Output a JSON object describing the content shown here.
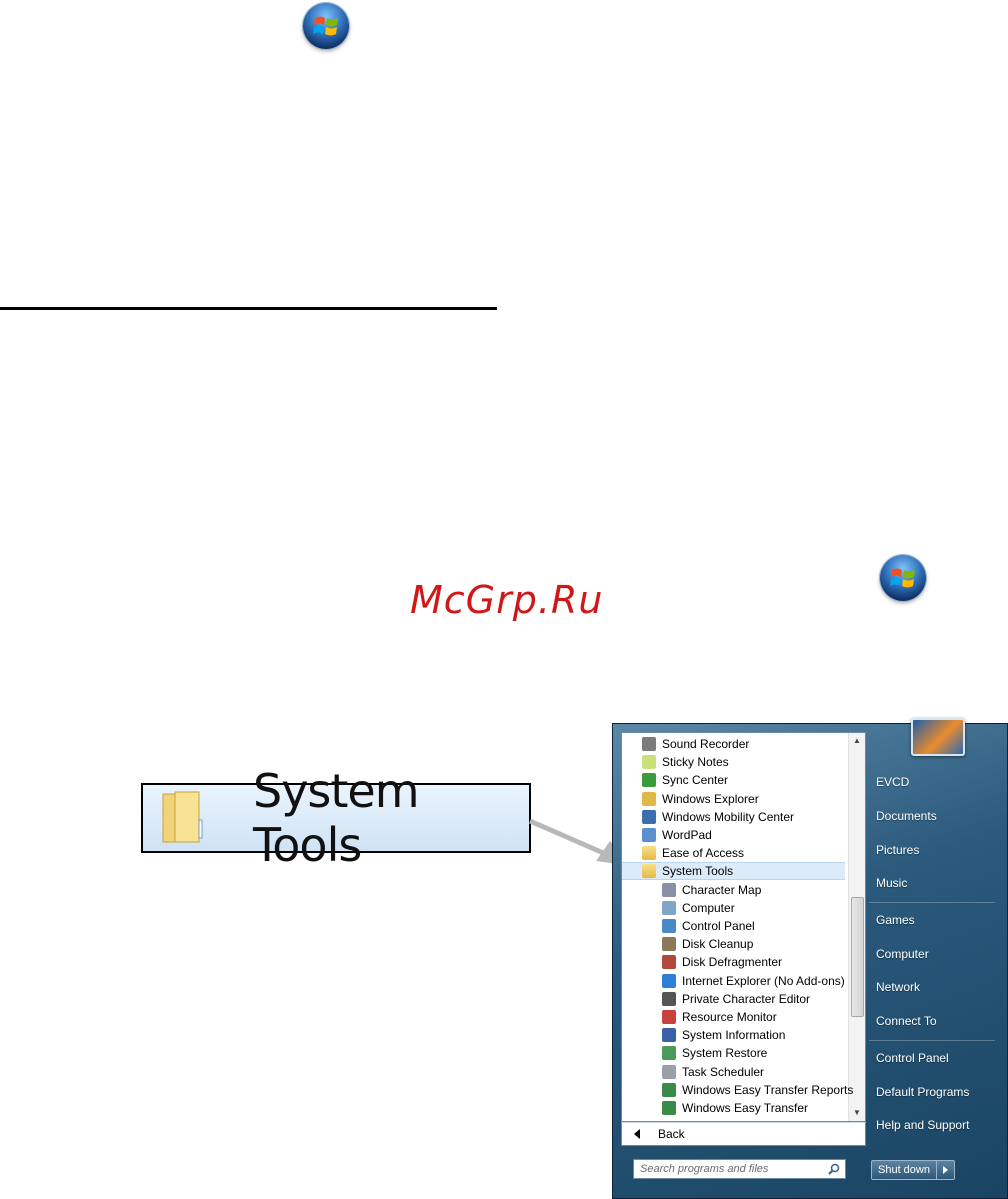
{
  "watermark": "McGrp.Ru",
  "callout": {
    "label": "System Tools"
  },
  "start_menu": {
    "programs": [
      {
        "label": "Sound Recorder",
        "icon": "microphone-icon",
        "level": 0,
        "color": "#7a7a7a"
      },
      {
        "label": "Sticky Notes",
        "icon": "sticky-notes-icon",
        "level": 0,
        "color": "#c9e07a"
      },
      {
        "label": "Sync Center",
        "icon": "sync-icon",
        "level": 0,
        "color": "#3a9b3a"
      },
      {
        "label": "Windows Explorer",
        "icon": "folder-explorer-icon",
        "level": 0,
        "color": "#e0b84a"
      },
      {
        "label": "Windows Mobility Center",
        "icon": "laptop-icon",
        "level": 0,
        "color": "#3b6fb0"
      },
      {
        "label": "WordPad",
        "icon": "wordpad-icon",
        "level": 0,
        "color": "#5a8fd0"
      },
      {
        "label": "Ease of Access",
        "icon": "folder-icon",
        "level": 0,
        "color": "#e5b944"
      },
      {
        "label": "System Tools",
        "icon": "folder-icon",
        "level": 0,
        "color": "#e5b944",
        "selected": true
      },
      {
        "label": "Character Map",
        "icon": "character-map-icon",
        "level": 1,
        "color": "#8a8fa8"
      },
      {
        "label": "Computer",
        "icon": "computer-icon",
        "level": 1,
        "color": "#7fa6c8"
      },
      {
        "label": "Control Panel",
        "icon": "control-panel-icon",
        "level": 1,
        "color": "#4a88c8"
      },
      {
        "label": "Disk Cleanup",
        "icon": "disk-cleanup-icon",
        "level": 1,
        "color": "#8a7a5a"
      },
      {
        "label": "Disk Defragmenter",
        "icon": "defrag-icon",
        "level": 1,
        "color": "#b04a3a"
      },
      {
        "label": "Internet Explorer (No Add-ons)",
        "icon": "internet-explorer-icon",
        "level": 1,
        "color": "#2f7fd8"
      },
      {
        "label": "Private Character Editor",
        "icon": "character-editor-icon",
        "level": 1,
        "color": "#555555"
      },
      {
        "label": "Resource Monitor",
        "icon": "resource-monitor-icon",
        "level": 1,
        "color": "#c84040"
      },
      {
        "label": "System Information",
        "icon": "system-info-icon",
        "level": 1,
        "color": "#3a60a8"
      },
      {
        "label": "System Restore",
        "icon": "system-restore-icon",
        "level": 1,
        "color": "#4a9a5a"
      },
      {
        "label": "Task Scheduler",
        "icon": "clock-icon",
        "level": 1,
        "color": "#9aa0a8"
      },
      {
        "label": "Windows Easy Transfer Reports",
        "icon": "easy-transfer-icon",
        "level": 1,
        "color": "#3a8a4a"
      },
      {
        "label": "Windows Easy Transfer",
        "icon": "easy-transfer-icon",
        "level": 1,
        "color": "#3a8a4a"
      }
    ],
    "back_label": "Back",
    "search_placeholder": "Search programs and files",
    "right_links": {
      "user": "EVCD",
      "documents": "Documents",
      "pictures": "Pictures",
      "music": "Music",
      "games": "Games",
      "computer": "Computer",
      "network": "Network",
      "connect_to": "Connect To",
      "control_panel": "Control Panel",
      "default_programs": "Default Programs",
      "help_support": "Help and Support"
    },
    "shutdown_label": "Shut down"
  }
}
